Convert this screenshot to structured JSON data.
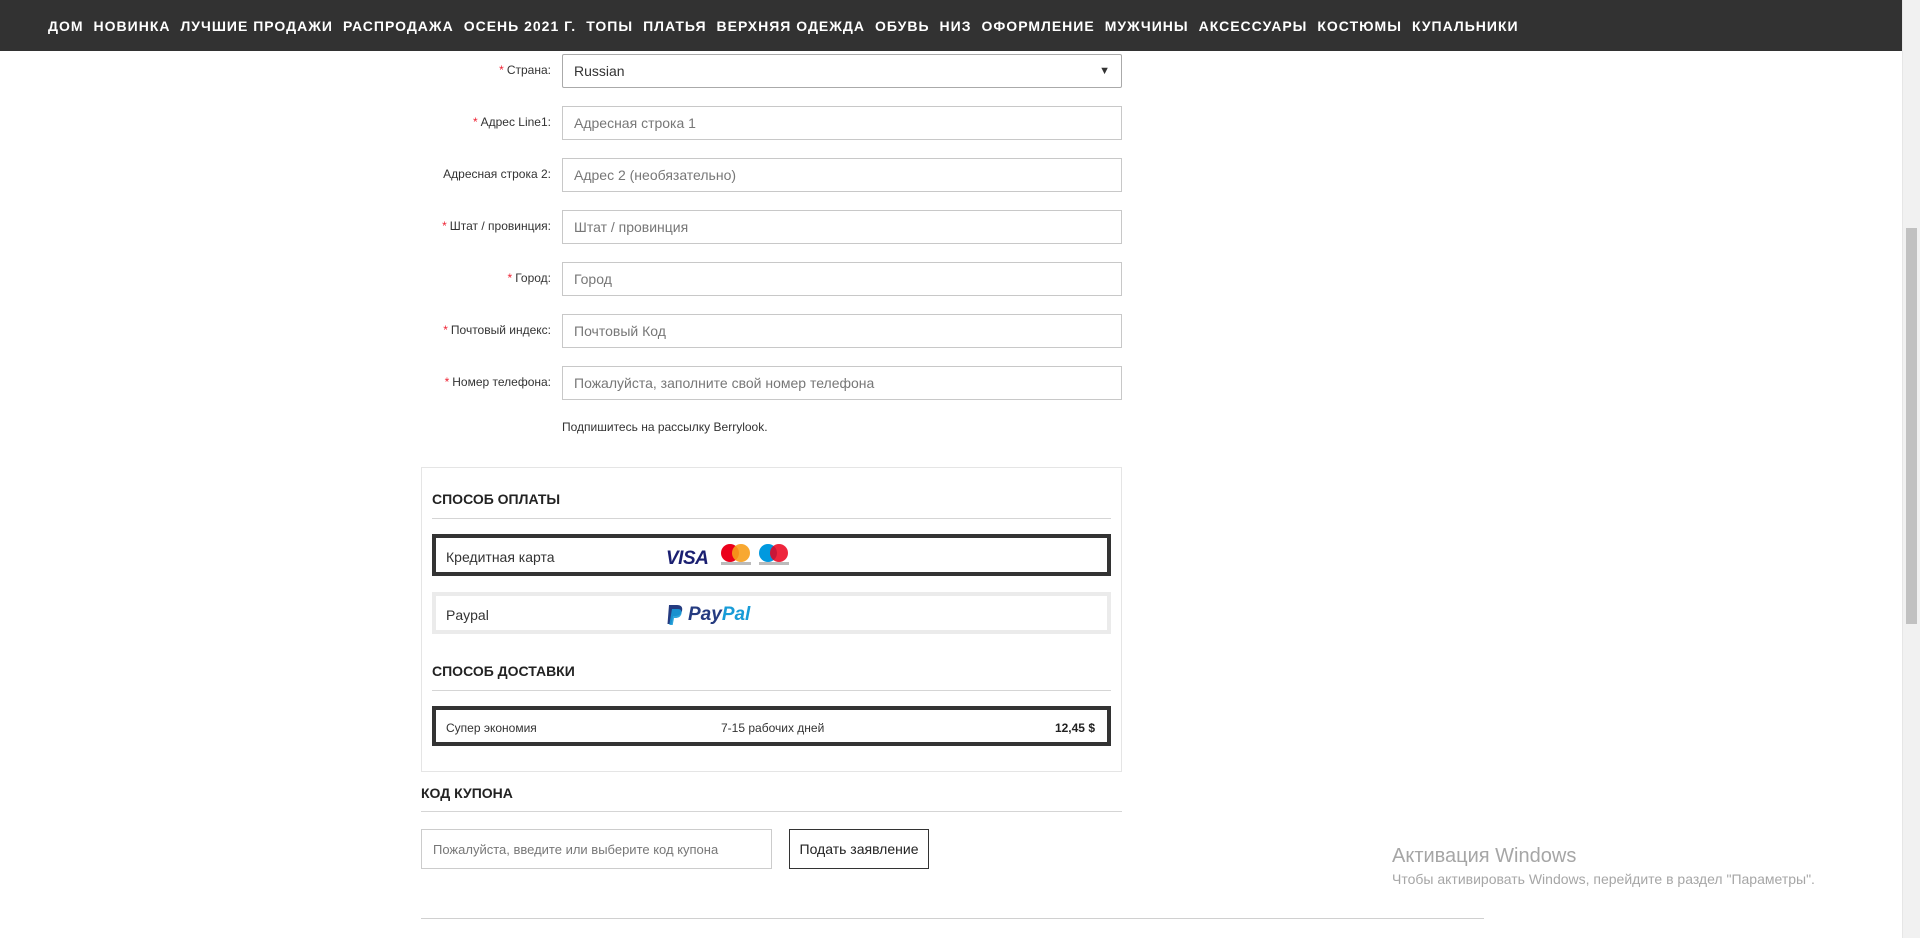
{
  "nav": {
    "items": [
      "ДОМ",
      "НОВИНКА",
      "ЛУЧШИЕ ПРОДАЖИ",
      "РАСПРОДАЖА",
      "ОСЕНЬ 2021 Г.",
      "ТОПЫ",
      "ПЛАТЬЯ",
      "ВЕРХНЯЯ ОДЕЖДА",
      "ОБУВЬ",
      "НИЗ",
      "ОФОРМЛЕНИЕ",
      "МУЖЧИНЫ",
      "АКСЕССУАРЫ",
      "КОСТЮМЫ",
      "КУПАЛЬНИКИ"
    ]
  },
  "form": {
    "required_mark": "*",
    "country": {
      "label": "Страна:",
      "value": "Russian"
    },
    "address1": {
      "label": "Адрес Line1:",
      "placeholder": "Адресная строка 1"
    },
    "address2": {
      "label": "Адресная строка 2:",
      "placeholder": "Адрес 2 (необязательно)"
    },
    "state": {
      "label": "Штат / провинция:",
      "placeholder": "Штат / провинция"
    },
    "city": {
      "label": "Город:",
      "placeholder": "Город"
    },
    "zip": {
      "label": "Почтовый индекс:",
      "placeholder": "Почтовый Код"
    },
    "phone": {
      "label": "Номер телефона:",
      "placeholder": "Пожалуйста, заполните свой номер телефона"
    },
    "subscribe_text": "Подпишитесь на рассылку Berrylook."
  },
  "payment": {
    "title": "СПОСОБ ОПЛАТЫ",
    "options": [
      {
        "label": "Кредитная карта",
        "logo_text": "VISA",
        "selected": true
      },
      {
        "label": "Paypal",
        "logo_text": "PayPal",
        "selected": false
      }
    ]
  },
  "shipping": {
    "title": "СПОСОБ ДОСТАВКИ",
    "option": {
      "name": "Супер экономия",
      "days": "7-15 рабочих дней",
      "price": "12,45 $"
    }
  },
  "coupon": {
    "title": "КОД КУПОНА",
    "placeholder": "Пожалуйста, введите или выберите код купона",
    "apply_label": "Подать заявление"
  },
  "watermark": {
    "title": "Активация Windows",
    "subtitle": "Чтобы активировать Windows, перейдите в раздел \"Параметры\"."
  },
  "colors": {
    "nav_bg": "#323232",
    "required": "#e22233",
    "selected_border": "#333333",
    "visa_blue": "#1a1f71",
    "paypal_dark": "#253b80",
    "paypal_light": "#179bd7"
  }
}
